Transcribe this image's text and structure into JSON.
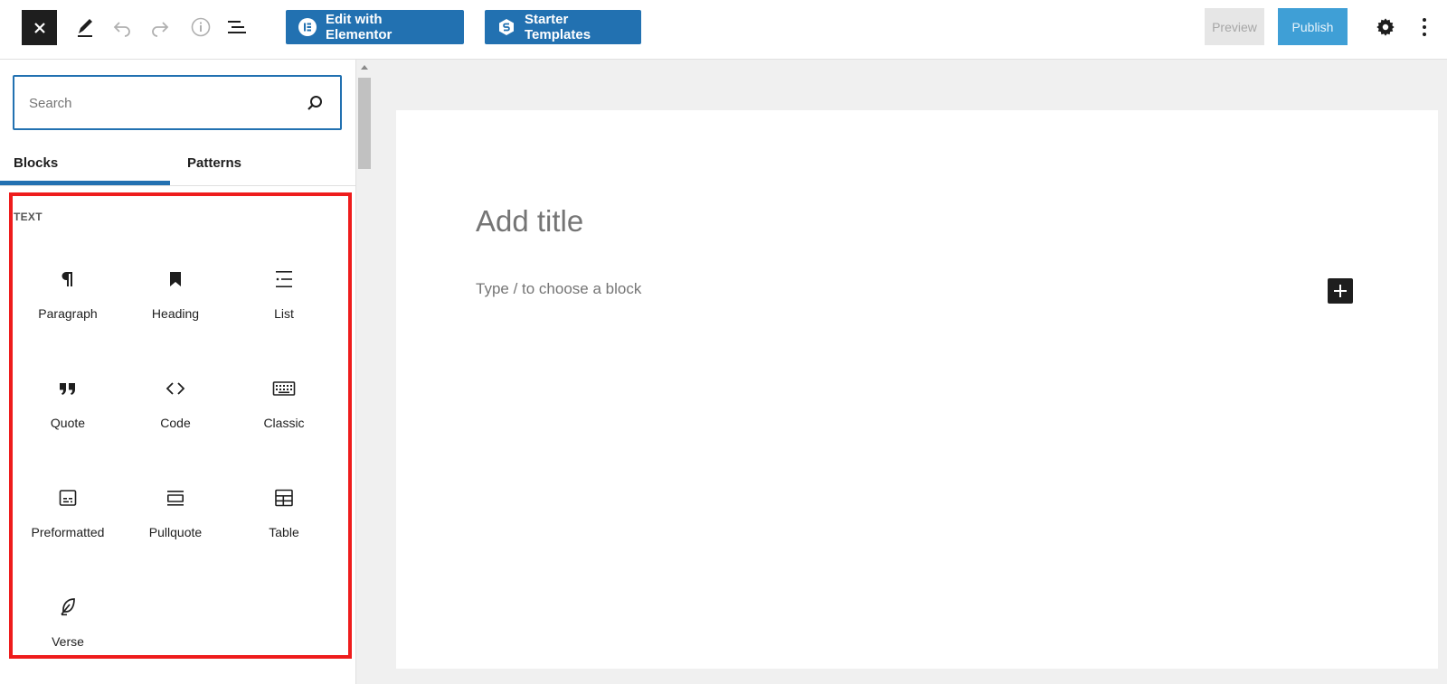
{
  "toolbar": {
    "elementor_label": "Edit with Elementor",
    "starter_label": "Starter Templates",
    "preview_label": "Preview",
    "publish_label": "Publish"
  },
  "sidebar": {
    "search_placeholder": "Search",
    "tabs": [
      {
        "label": "Blocks"
      },
      {
        "label": "Patterns"
      }
    ],
    "category": "TEXT",
    "blocks": [
      {
        "label": "Paragraph",
        "icon": "paragraph-icon"
      },
      {
        "label": "Heading",
        "icon": "heading-icon"
      },
      {
        "label": "List",
        "icon": "list-icon"
      },
      {
        "label": "Quote",
        "icon": "quote-icon"
      },
      {
        "label": "Code",
        "icon": "code-icon"
      },
      {
        "label": "Classic",
        "icon": "keyboard-icon"
      },
      {
        "label": "Preformatted",
        "icon": "preformatted-icon"
      },
      {
        "label": "Pullquote",
        "icon": "pullquote-icon"
      },
      {
        "label": "Table",
        "icon": "table-icon"
      },
      {
        "label": "Verse",
        "icon": "feather-icon"
      }
    ]
  },
  "editor": {
    "title_placeholder": "Add title",
    "block_placeholder": "Type / to choose a block"
  },
  "colors": {
    "accent": "#2271b1",
    "highlight": "#ee1c1c",
    "publish": "#3f9fd6"
  }
}
